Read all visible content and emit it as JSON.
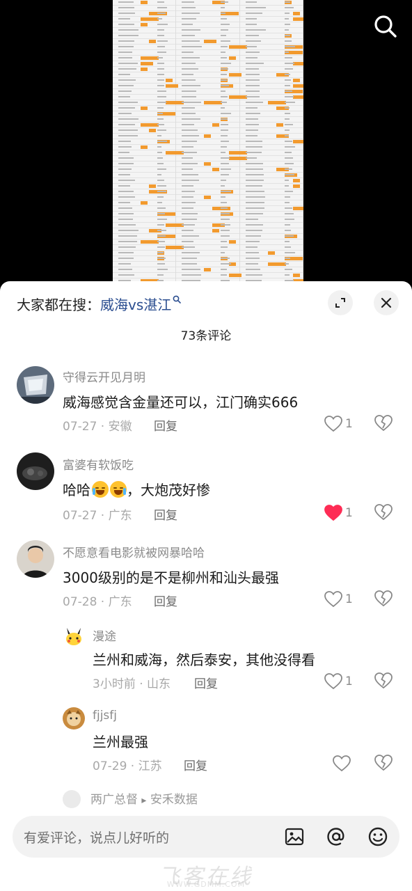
{
  "header": {
    "hot_search_prefix": "大家都在搜：",
    "hot_search_term": "威海vs湛江"
  },
  "panel": {
    "comment_count": "73条评论"
  },
  "comments": [
    {
      "user": "守得云开见月明",
      "text": "威海感觉含金量还可以，江门确实666",
      "date": "07-27",
      "location": "安徽",
      "reply_label": "回复",
      "likes": "1",
      "liked": false
    },
    {
      "user": "富婆有软饭吃",
      "text_before": "哈哈",
      "text_after": "，大炮茂好惨",
      "emoji": "crying-laughing-emoji",
      "date": "07-27",
      "location": "广东",
      "reply_label": "回复",
      "likes": "1",
      "liked": true
    },
    {
      "user": "不愿意看电影就被网暴哈哈",
      "text": "3000级别的是不是柳州和汕头最强",
      "date": "07-28",
      "location": "广东",
      "reply_label": "回复",
      "likes": "1",
      "liked": false,
      "replies": [
        {
          "user": "漫途",
          "text": "兰州和威海，然后泰安，其他没得看",
          "date": "3小时前",
          "location": "山东",
          "reply_label": "回复",
          "likes": "1"
        },
        {
          "user": "fjjsfj",
          "text": "兰州最强",
          "date": "07-29",
          "location": "江苏",
          "reply_label": "回复",
          "likes": ""
        }
      ],
      "more_replies": {
        "user": "两广总督",
        "arrow": "▸",
        "reply_to": "安禾数据"
      }
    }
  ],
  "input": {
    "placeholder": "有爱评论，说点儿好听的"
  },
  "icons": {
    "search": "search-icon",
    "expand": "expand-icon",
    "close": "close-icon",
    "heart": "heart-icon",
    "dislike": "broken-heart-icon",
    "image": "image-icon",
    "at": "at-icon",
    "emoji": "emoji-icon"
  },
  "colors": {
    "link": "#2a4d8f",
    "liked_heart": "#fe2c55",
    "sheet_highlight": "#f29a2e"
  },
  "watermark": {
    "text": "飞客在线",
    "url": "WWW.GDMM.COM"
  }
}
